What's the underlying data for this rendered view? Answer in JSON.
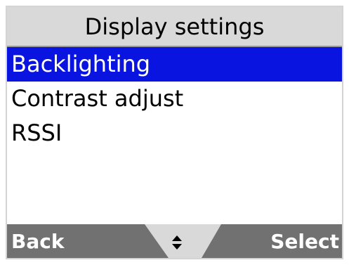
{
  "screen": {
    "title": "Display settings"
  },
  "menu": {
    "items": [
      {
        "label": "Backlighting",
        "selected": true
      },
      {
        "label": "Contrast adjust",
        "selected": false
      },
      {
        "label": "RSSI",
        "selected": false
      }
    ]
  },
  "softkeys": {
    "left_label": "Back",
    "right_label": "Select",
    "center_icon": "up-down-arrows-icon"
  },
  "colors": {
    "selection": "#0a14e0",
    "softkey_background": "#717171",
    "title_background": "#d9d9d9"
  }
}
